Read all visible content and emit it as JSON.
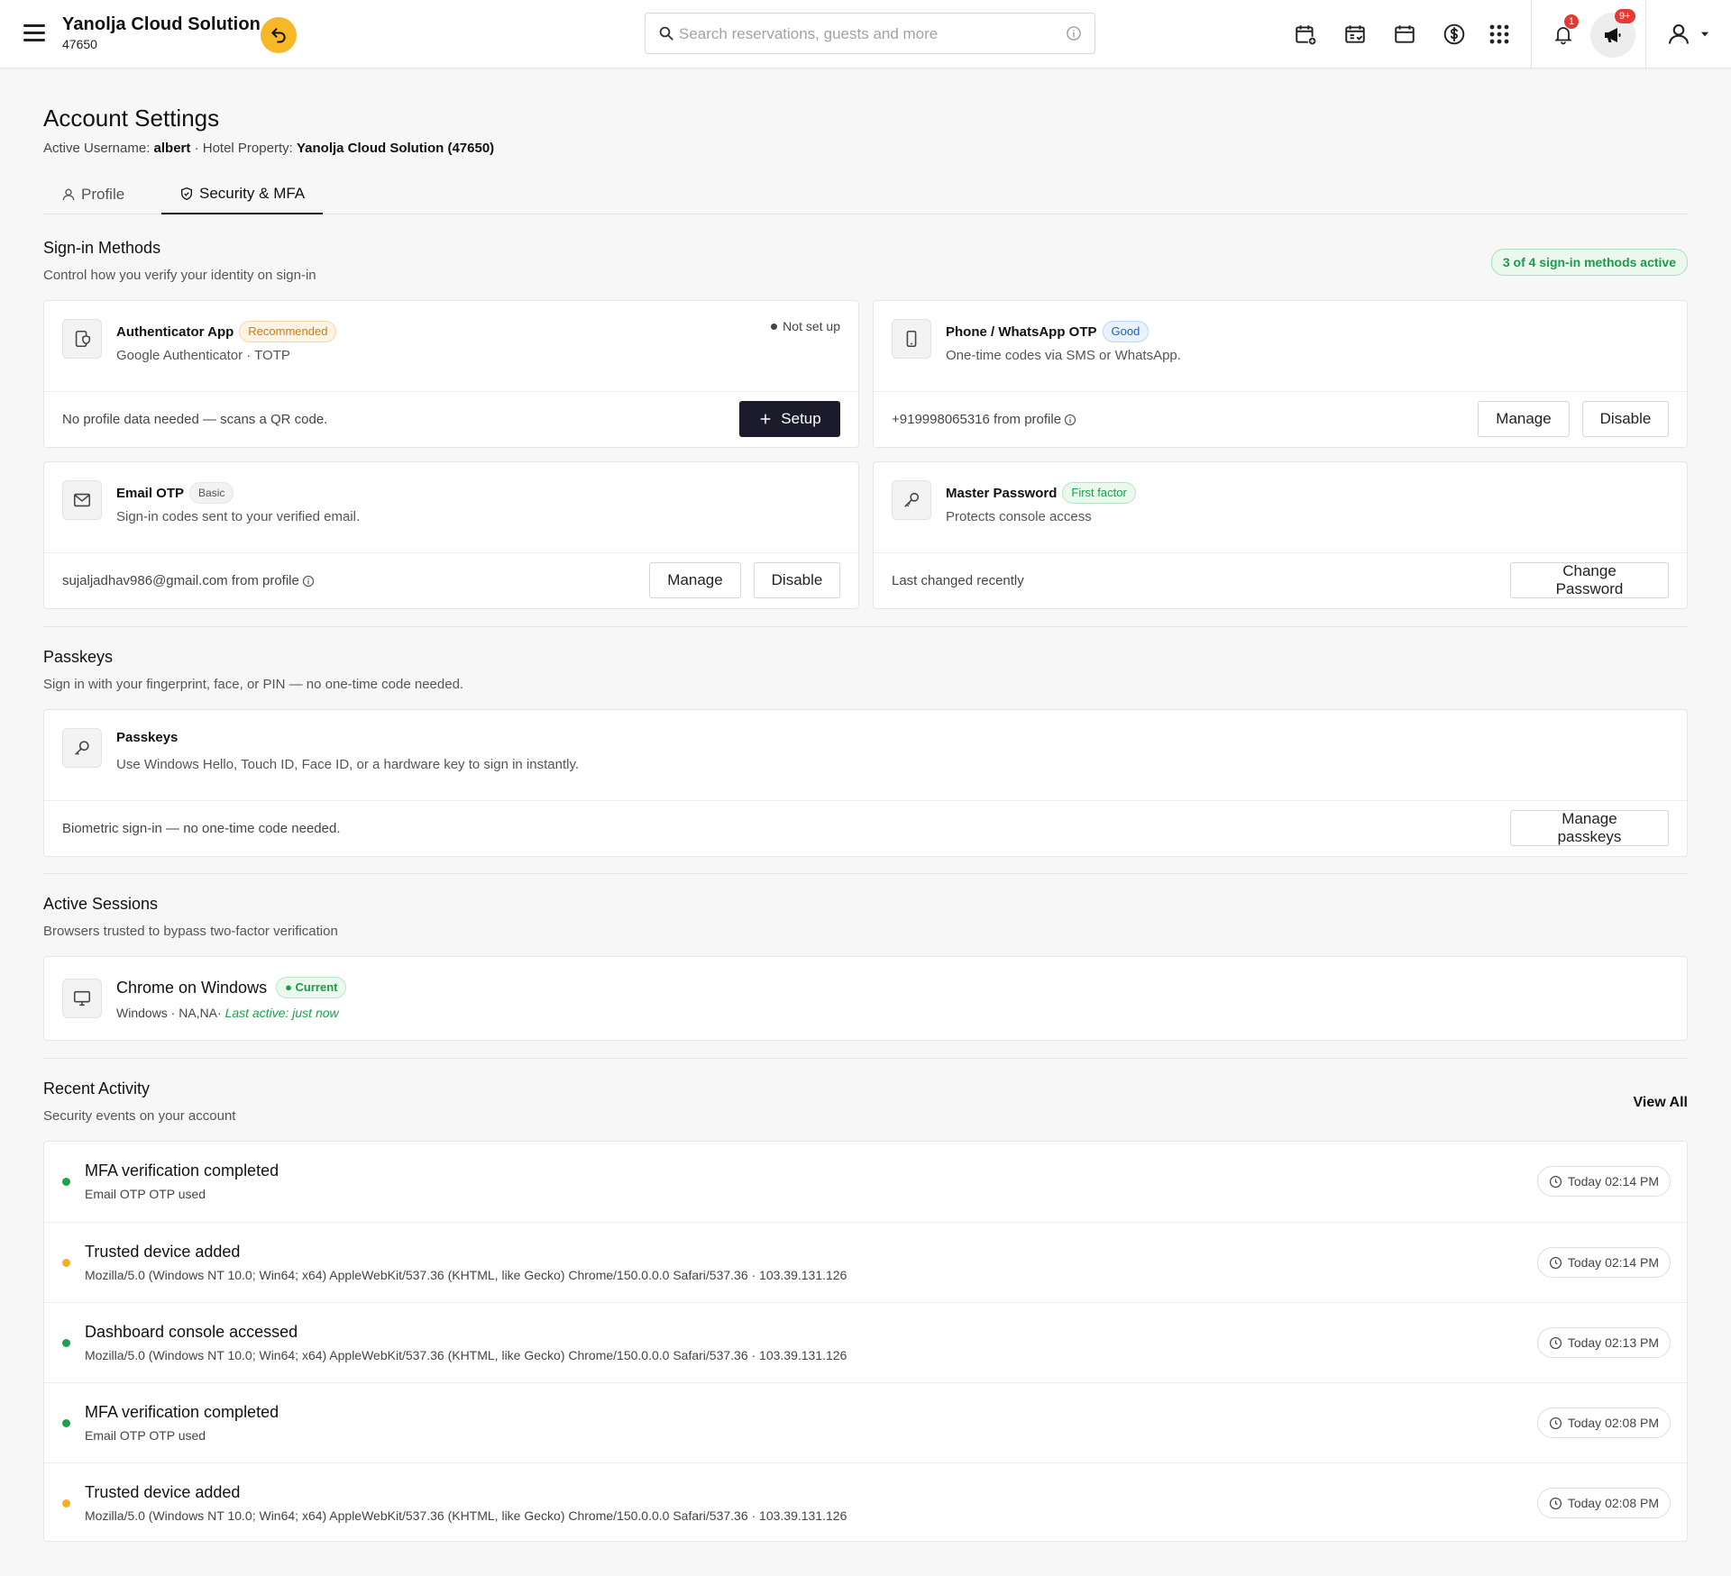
{
  "header": {
    "brand_name": "Yanolja Cloud Solution",
    "brand_id": "47650",
    "search_placeholder": "Search reservations, guests and more",
    "notification_count": "1",
    "announcement_count": "9+"
  },
  "page": {
    "title": "Account Settings",
    "username_label": "Active Username:",
    "username": "albert",
    "property_label": "· Hotel Property:",
    "property": "Yanolja Cloud Solution (47650)"
  },
  "tabs": [
    {
      "label": "Profile",
      "active": false
    },
    {
      "label": "Security & MFA",
      "active": true
    }
  ],
  "signin": {
    "title": "Sign-in Methods",
    "subtitle": "Control how you verify your identity on sign-in",
    "active_badge": "3 of 4 sign-in methods active",
    "authenticator": {
      "title": "Authenticator App",
      "badge": "Recommended",
      "description": "Google Authenticator · TOTP",
      "status": "Not set up",
      "footer": "No profile data needed — scans a QR code.",
      "setup_label": "Setup"
    },
    "phone": {
      "title": "Phone / WhatsApp OTP",
      "badge": "Good",
      "description": "One-time codes via SMS or WhatsApp.",
      "footer": "+919998065316 from profile",
      "manage_label": "Manage",
      "disable_label": "Disable"
    },
    "email": {
      "title": "Email OTP",
      "badge": "Basic",
      "description": "Sign-in codes sent to your verified email.",
      "footer": "sujaljadhav986@gmail.com from profile",
      "manage_label": "Manage",
      "disable_label": "Disable"
    },
    "password": {
      "title": "Master Password",
      "badge": "First factor",
      "description": "Protects console access",
      "footer": "Last changed recently",
      "change_label": "Change Password"
    }
  },
  "passkeys": {
    "title": "Passkeys",
    "subtitle": "Sign in with your fingerprint, face, or PIN — no one-time code needed.",
    "card_title": "Passkeys",
    "card_description": "Use Windows Hello, Touch ID, Face ID, or a hardware key to sign in instantly.",
    "footer": "Biometric sign-in — no one-time code needed.",
    "manage_label": "Manage passkeys"
  },
  "sessions": {
    "title": "Active Sessions",
    "subtitle": "Browsers trusted to bypass two-factor verification",
    "device": "Chrome on Windows",
    "badge": "Current",
    "details": "Windows · NA,NA·",
    "last_active": "Last active: just now"
  },
  "activity": {
    "title": "Recent Activity",
    "subtitle": "Security events on your account",
    "view_all": "View All",
    "items": [
      {
        "title": "MFA verification completed",
        "description": "Email OTP OTP used",
        "time": "Today 02:14 PM",
        "color": "#1aa34a"
      },
      {
        "title": "Trusted device added",
        "description": "Mozilla/5.0 (Windows NT 10.0; Win64; x64) AppleWebKit/537.36 (KHTML, like Gecko) Chrome/150.0.0.0 Safari/537.36 · 103.39.131.126",
        "time": "Today 02:14 PM",
        "color": "#f2b01e"
      },
      {
        "title": "Dashboard console accessed",
        "description": "Mozilla/5.0 (Windows NT 10.0; Win64; x64) AppleWebKit/537.36 (KHTML, like Gecko) Chrome/150.0.0.0 Safari/537.36 · 103.39.131.126",
        "time": "Today 02:13 PM",
        "color": "#1aa34a"
      },
      {
        "title": "MFA verification completed",
        "description": "Email OTP OTP used",
        "time": "Today 02:08 PM",
        "color": "#1aa34a"
      },
      {
        "title": "Trusted device added",
        "description": "Mozilla/5.0 (Windows NT 10.0; Win64; x64) AppleWebKit/537.36 (KHTML, like Gecko) Chrome/150.0.0.0 Safari/537.36 · 103.39.131.126",
        "time": "Today 02:08 PM",
        "color": "#f2b01e"
      }
    ]
  },
  "colors": {
    "accent_dark": "#1c1b2b",
    "brand_yellow": "#f6b826",
    "success": "#1aa34a",
    "warning": "#f2b01e"
  }
}
